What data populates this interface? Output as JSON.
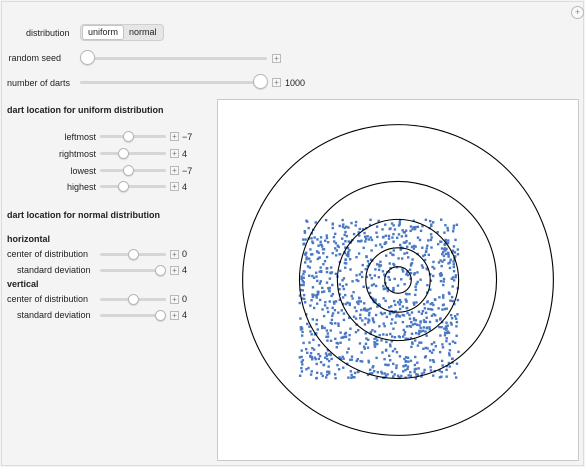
{
  "controls": {
    "distribution_label": "distribution",
    "distribution_options": [
      "uniform",
      "normal"
    ],
    "distribution_selected": "uniform",
    "random_seed_label": "random seed",
    "random_seed_value": 0,
    "num_darts_label": "number of darts",
    "num_darts_value": "1000",
    "num_darts_fraction": 1.0
  },
  "uniform": {
    "heading": "dart location for uniform distribution",
    "leftmost_label": "leftmost",
    "leftmost_value": "−7",
    "rightmost_label": "rightmost",
    "rightmost_value": "4",
    "lowest_label": "lowest",
    "lowest_value": "−7",
    "highest_label": "highest",
    "highest_value": "4"
  },
  "normal": {
    "heading": "dart location for normal distribution",
    "horizontal_label": "horizontal",
    "h_center_label": "center of distribution",
    "h_center_value": "0",
    "h_sd_label": "standard deviation",
    "h_sd_value": "4",
    "vertical_label": "vertical",
    "v_center_label": "center of distribution",
    "v_center_value": "0",
    "v_sd_label": "standard deviation",
    "v_sd_value": "4"
  },
  "chart_data": {
    "type": "scatter",
    "title": "",
    "xlabel": "",
    "ylabel": "",
    "xlim": [
      -19,
      19
    ],
    "ylim": [
      -19,
      19
    ],
    "rings": [
      1.4,
      3.4,
      6.4,
      10.4,
      16.4
    ],
    "points": {
      "distribution": "uniform",
      "count": 1000,
      "x_range": [
        -10.4,
        6.4
      ],
      "y_range": [
        -10.4,
        6.4
      ]
    },
    "point_color": "#4a79c4",
    "ring_color": "#000000"
  }
}
